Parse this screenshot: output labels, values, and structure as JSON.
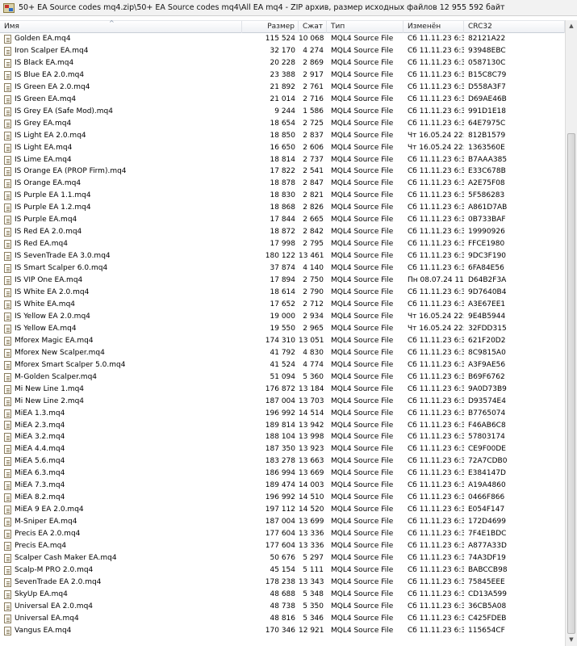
{
  "window": {
    "title": "50+ EA Source codes mq4.zip\\50+ EA Source codes mq4\\All EA mq4 - ZIP архив, размер исходных файлов 12 955 592 байт"
  },
  "columns": {
    "name": "Имя",
    "size": "Размер",
    "packed": "Сжат",
    "type": "Тип",
    "modified": "Изменён",
    "crc": "CRC32"
  },
  "files": [
    {
      "name": "Golden EA.mq4",
      "size": "115 524",
      "packed": "10 068",
      "type": "MQL4 Source File",
      "modified": "Сб 11.11.23 6:39",
      "crc": "82121A22"
    },
    {
      "name": "Iron Scalper EA.mq4",
      "size": "32 170",
      "packed": "4 274",
      "type": "MQL4 Source File",
      "modified": "Сб 11.11.23 6:39",
      "crc": "93948EBC"
    },
    {
      "name": "IS Black EA.mq4",
      "size": "20 228",
      "packed": "2 869",
      "type": "MQL4 Source File",
      "modified": "Сб 11.11.23 6:39",
      "crc": "0587130C"
    },
    {
      "name": "IS Blue EA 2.0.mq4",
      "size": "23 388",
      "packed": "2 917",
      "type": "MQL4 Source File",
      "modified": "Сб 11.11.23 6:39",
      "crc": "B15C8C79"
    },
    {
      "name": "IS Green EA 2.0.mq4",
      "size": "21 892",
      "packed": "2 761",
      "type": "MQL4 Source File",
      "modified": "Сб 11.11.23 6:39",
      "crc": "D558A3F7"
    },
    {
      "name": "IS Green EA.mq4",
      "size": "21 014",
      "packed": "2 716",
      "type": "MQL4 Source File",
      "modified": "Сб 11.11.23 6:39",
      "crc": "D69AE46B"
    },
    {
      "name": "IS Grey EA (Safe Mod).mq4",
      "size": "9 244",
      "packed": "1 586",
      "type": "MQL4 Source File",
      "modified": "Сб 11.11.23 6:39",
      "crc": "991D1E18"
    },
    {
      "name": "IS Grey EA.mq4",
      "size": "18 654",
      "packed": "2 725",
      "type": "MQL4 Source File",
      "modified": "Сб 11.11.23 6:39",
      "crc": "64E7975C"
    },
    {
      "name": "IS Light EA 2.0.mq4",
      "size": "18 850",
      "packed": "2 837",
      "type": "MQL4 Source File",
      "modified": "Чт 16.05.24 22:08",
      "crc": "812B1579"
    },
    {
      "name": "IS Light EA.mq4",
      "size": "16 650",
      "packed": "2 606",
      "type": "MQL4 Source File",
      "modified": "Чт 16.05.24 22:09",
      "crc": "1363560E"
    },
    {
      "name": "IS Lime EA.mq4",
      "size": "18 814",
      "packed": "2 737",
      "type": "MQL4 Source File",
      "modified": "Сб 11.11.23 6:39",
      "crc": "B7AAA385"
    },
    {
      "name": "IS Orange EA (PROP Firm).mq4",
      "size": "17 822",
      "packed": "2 541",
      "type": "MQL4 Source File",
      "modified": "Сб 11.11.23 6:39",
      "crc": "E33C678B"
    },
    {
      "name": "IS Orange EA.mq4",
      "size": "18 878",
      "packed": "2 847",
      "type": "MQL4 Source File",
      "modified": "Сб 11.11.23 6:39",
      "crc": "A2E75F08"
    },
    {
      "name": "IS Purple EA 1.1.mq4",
      "size": "18 830",
      "packed": "2 821",
      "type": "MQL4 Source File",
      "modified": "Сб 11.11.23 6:39",
      "crc": "5F586283"
    },
    {
      "name": "IS Purple EA 1.2.mq4",
      "size": "18 868",
      "packed": "2 826",
      "type": "MQL4 Source File",
      "modified": "Сб 11.11.23 6:39",
      "crc": "A861D7AB"
    },
    {
      "name": "IS Purple EA.mq4",
      "size": "17 844",
      "packed": "2 665",
      "type": "MQL4 Source File",
      "modified": "Сб 11.11.23 6:39",
      "crc": "0B733BAF"
    },
    {
      "name": "IS Red EA 2.0.mq4",
      "size": "18 872",
      "packed": "2 842",
      "type": "MQL4 Source File",
      "modified": "Сб 11.11.23 6:39",
      "crc": "19990926"
    },
    {
      "name": "IS Red EA.mq4",
      "size": "17 998",
      "packed": "2 795",
      "type": "MQL4 Source File",
      "modified": "Сб 11.11.23 6:39",
      "crc": "FFCE1980"
    },
    {
      "name": "IS SevenTrade EA 3.0.mq4",
      "size": "180 122",
      "packed": "13 461",
      "type": "MQL4 Source File",
      "modified": "Сб 11.11.23 6:39",
      "crc": "9DC3F190"
    },
    {
      "name": "IS Smart Scalper 6.0.mq4",
      "size": "37 874",
      "packed": "4 140",
      "type": "MQL4 Source File",
      "modified": "Сб 11.11.23 6:39",
      "crc": "6FA84E56"
    },
    {
      "name": "IS VIP One EA.mq4",
      "size": "17 894",
      "packed": "2 750",
      "type": "MQL4 Source File",
      "modified": "Пн 08.07.24 11:...",
      "crc": "D64B2F3A"
    },
    {
      "name": "IS White EA 2.0.mq4",
      "size": "18 614",
      "packed": "2 790",
      "type": "MQL4 Source File",
      "modified": "Сб 11.11.23 6:39",
      "crc": "9D7640B4"
    },
    {
      "name": "IS White EA.mq4",
      "size": "17 652",
      "packed": "2 712",
      "type": "MQL4 Source File",
      "modified": "Сб 11.11.23 6:39",
      "crc": "A3E67EE1"
    },
    {
      "name": "IS Yellow EA 2.0.mq4",
      "size": "19 000",
      "packed": "2 934",
      "type": "MQL4 Source File",
      "modified": "Чт 16.05.24 22:08",
      "crc": "9E4B5944"
    },
    {
      "name": "IS Yellow EA.mq4",
      "size": "19 550",
      "packed": "2 965",
      "type": "MQL4 Source File",
      "modified": "Чт 16.05.24 22:08",
      "crc": "32FDD315"
    },
    {
      "name": "Mforex Magic EA.mq4",
      "size": "174 310",
      "packed": "13 051",
      "type": "MQL4 Source File",
      "modified": "Сб 11.11.23 6:39",
      "crc": "621F20D2"
    },
    {
      "name": "Mforex New Scalper.mq4",
      "size": "41 792",
      "packed": "4 830",
      "type": "MQL4 Source File",
      "modified": "Сб 11.11.23 6:39",
      "crc": "8C9815A0"
    },
    {
      "name": "Mforex Smart Scalper 5.0.mq4",
      "size": "41 524",
      "packed": "4 774",
      "type": "MQL4 Source File",
      "modified": "Сб 11.11.23 6:39",
      "crc": "A3F9AE56"
    },
    {
      "name": "M-Golden Scalper.mq4",
      "size": "51 094",
      "packed": "5 360",
      "type": "MQL4 Source File",
      "modified": "Сб 11.11.23 6:39",
      "crc": "B69F6762"
    },
    {
      "name": "Mi New Line 1.mq4",
      "size": "176 872",
      "packed": "13 184",
      "type": "MQL4 Source File",
      "modified": "Сб 11.11.23 6:39",
      "crc": "9A0D73B9"
    },
    {
      "name": "Mi New Line 2.mq4",
      "size": "187 004",
      "packed": "13 703",
      "type": "MQL4 Source File",
      "modified": "Сб 11.11.23 6:39",
      "crc": "D93574E4"
    },
    {
      "name": "MiEA 1.3.mq4",
      "size": "196 992",
      "packed": "14 514",
      "type": "MQL4 Source File",
      "modified": "Сб 11.11.23 6:39",
      "crc": "B7765074"
    },
    {
      "name": "MiEA 2.3.mq4",
      "size": "189 814",
      "packed": "13 942",
      "type": "MQL4 Source File",
      "modified": "Сб 11.11.23 6:39",
      "crc": "F46AB6C8"
    },
    {
      "name": "MiEA 3.2.mq4",
      "size": "188 104",
      "packed": "13 998",
      "type": "MQL4 Source File",
      "modified": "Сб 11.11.23 6:39",
      "crc": "57803174"
    },
    {
      "name": "MiEA 4.4.mq4",
      "size": "187 350",
      "packed": "13 923",
      "type": "MQL4 Source File",
      "modified": "Сб 11.11.23 6:39",
      "crc": "CE9F00DE"
    },
    {
      "name": "MiEA 5.6.mq4",
      "size": "183 278",
      "packed": "13 663",
      "type": "MQL4 Source File",
      "modified": "Сб 11.11.23 6:39",
      "crc": "72A7CDB0"
    },
    {
      "name": "MiEA 6.3.mq4",
      "size": "186 994",
      "packed": "13 669",
      "type": "MQL4 Source File",
      "modified": "Сб 11.11.23 6:39",
      "crc": "E384147D"
    },
    {
      "name": "MiEA 7.3.mq4",
      "size": "189 474",
      "packed": "14 003",
      "type": "MQL4 Source File",
      "modified": "Сб 11.11.23 6:39",
      "crc": "A19A4860"
    },
    {
      "name": "MiEA 8.2.mq4",
      "size": "196 992",
      "packed": "14 510",
      "type": "MQL4 Source File",
      "modified": "Сб 11.11.23 6:39",
      "crc": "0466F866"
    },
    {
      "name": "MiEA 9 EA 2.0.mq4",
      "size": "197 112",
      "packed": "14 520",
      "type": "MQL4 Source File",
      "modified": "Сб 11.11.23 6:39",
      "crc": "E054F147"
    },
    {
      "name": "M-Sniper EA.mq4",
      "size": "187 004",
      "packed": "13 699",
      "type": "MQL4 Source File",
      "modified": "Сб 11.11.23 6:39",
      "crc": "172D4699"
    },
    {
      "name": "Precis EA 2.0.mq4",
      "size": "177 604",
      "packed": "13 336",
      "type": "MQL4 Source File",
      "modified": "Сб 11.11.23 6:39",
      "crc": "7F4E1BDC"
    },
    {
      "name": "Precis EA.mq4",
      "size": "177 604",
      "packed": "13 336",
      "type": "MQL4 Source File",
      "modified": "Сб 11.11.23 6:39",
      "crc": "A877A33D"
    },
    {
      "name": "Scalper Cash Maker EA.mq4",
      "size": "50 676",
      "packed": "5 297",
      "type": "MQL4 Source File",
      "modified": "Сб 11.11.23 6:39",
      "crc": "74A3DF19"
    },
    {
      "name": "Scalp-M PRO 2.0.mq4",
      "size": "45 154",
      "packed": "5 111",
      "type": "MQL4 Source File",
      "modified": "Сб 11.11.23 6:39",
      "crc": "BABCCB98"
    },
    {
      "name": "SevenTrade EA 2.0.mq4",
      "size": "178 238",
      "packed": "13 343",
      "type": "MQL4 Source File",
      "modified": "Сб 11.11.23 6:39",
      "crc": "75845EEE"
    },
    {
      "name": "SkyUp EA.mq4",
      "size": "48 688",
      "packed": "5 348",
      "type": "MQL4 Source File",
      "modified": "Сб 11.11.23 6:39",
      "crc": "CD13A599"
    },
    {
      "name": "Universal EA 2.0.mq4",
      "size": "48 738",
      "packed": "5 350",
      "type": "MQL4 Source File",
      "modified": "Сб 11.11.23 6:39",
      "crc": "36CB5A08"
    },
    {
      "name": "Universal EA.mq4",
      "size": "48 816",
      "packed": "5 346",
      "type": "MQL4 Source File",
      "modified": "Сб 11.11.23 6:39",
      "crc": "C425FDEB"
    },
    {
      "name": "Vangus EA.mq4",
      "size": "170 346",
      "packed": "12 921",
      "type": "MQL4 Source File",
      "modified": "Сб 11.11.23 6:39",
      "crc": "115654CF"
    }
  ]
}
